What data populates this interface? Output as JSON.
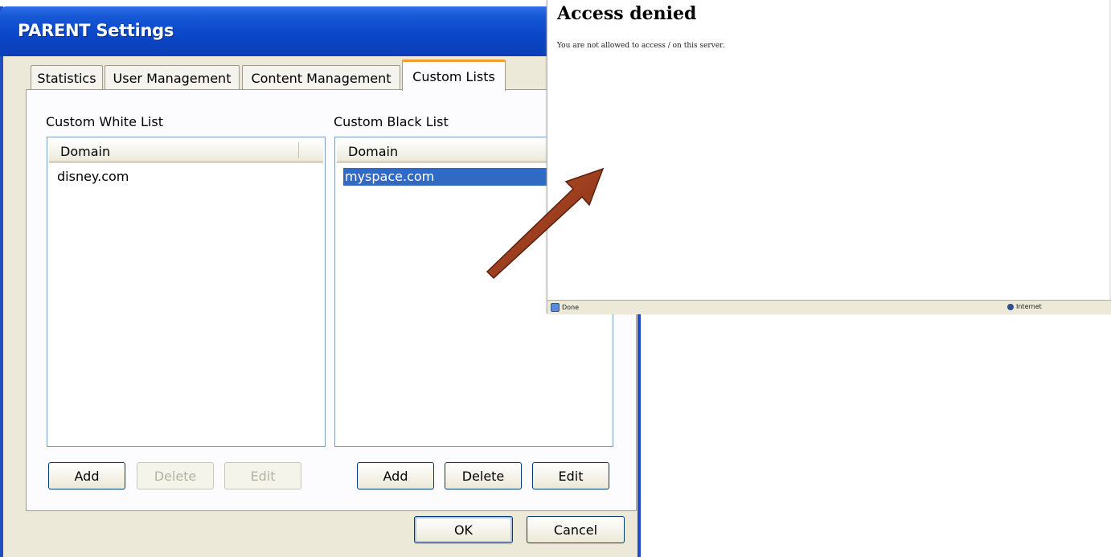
{
  "dialog": {
    "title": "PARENT Settings",
    "tabs": [
      {
        "label": "Statistics"
      },
      {
        "label": "User Management"
      },
      {
        "label": "Content Management"
      },
      {
        "label": "Custom Lists",
        "active": true
      }
    ],
    "white_list": {
      "label": "Custom White List",
      "column": "Domain",
      "rows": [
        "disney.com"
      ],
      "buttons": {
        "add": "Add",
        "delete": "Delete",
        "edit": "Edit"
      }
    },
    "black_list": {
      "label": "Custom Black List",
      "column": "Domain",
      "rows": [
        "myspace.com"
      ],
      "selected_row": "myspace.com",
      "buttons": {
        "add": "Add",
        "delete": "Delete",
        "edit": "Edit"
      }
    },
    "ok_label": "OK",
    "cancel_label": "Cancel"
  },
  "browser": {
    "heading": "Access denied",
    "message": "You are not allowed to access / on this server.",
    "status_left": "Done",
    "status_right": "Internet"
  },
  "colors": {
    "titlebar": "#0b46c7",
    "selection": "#316ac5",
    "active_tab_accent": "#f3a02a",
    "arrow": "#9b3b1e"
  }
}
